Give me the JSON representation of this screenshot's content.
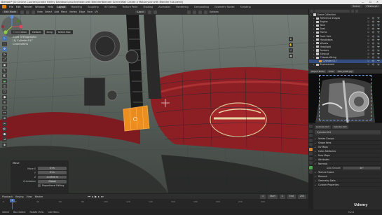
{
  "window": {
    "title": "Blender* [D:\\Online Courses\\Create Harley Davidson\\knucklehead with Blender\\Blender Scene\\Wall Create a Motorcycle with Blender 5.8.blend]",
    "controls": "—  ☐  ✕"
  },
  "menu": {
    "items": [
      "File",
      "Edit",
      "Render",
      "Window",
      "Help"
    ],
    "workspaces": [
      "Layout",
      "Modeling",
      "Sculpting",
      "UV Editing",
      "Texture Paint",
      "Shading",
      "Animation",
      "Rendering",
      "Compositing",
      "Geometry Nodes",
      "Scripting"
    ],
    "active_workspace": "Layout",
    "scene": "Scene",
    "view_layer": "ViewLayer"
  },
  "viewport_header": {
    "mode": "Edit Mode",
    "view": "View",
    "select": "Select",
    "add": "Add",
    "mesh": "Mesh",
    "vertex": "Vertex",
    "edge": "Edge",
    "face": "Face",
    "uv": "UV",
    "transform": "Local",
    "options": "Options"
  },
  "tool_header": {
    "orientation": "Orientation",
    "pivot": "Default",
    "drag": "Drag",
    "select_box": "Select Box"
  },
  "viewport_overlay": {
    "line1": "Right Orthographic",
    "line2": "(1) Cylinder.017",
    "line3": "Centimeters"
  },
  "toolbar": {
    "tools": [
      "↖",
      "⬚",
      "✥",
      "⟳",
      "⤢",
      "▣",
      "✎",
      "◧",
      "⬓",
      "◫",
      "⬡",
      "⬢",
      "◎",
      "⊙",
      "↔",
      "⊕",
      "✂",
      "◐",
      "⬣",
      "⊿",
      "◈"
    ]
  },
  "operator_panel": {
    "title": "Move",
    "fields": [
      {
        "label": "Move X",
        "value": "0 m"
      },
      {
        "label": "Y",
        "value": "0 m"
      },
      {
        "label": "Z",
        "value": "-0.0703 m"
      },
      {
        "label": "Orientation",
        "value": "Global"
      }
    ],
    "checkbox_label": "Proportional Editing"
  },
  "timeline": {
    "menus": [
      "Playback",
      "Keying",
      "View",
      "Marker"
    ],
    "current_frame": "1",
    "start_label": "Start",
    "start": "1",
    "end_label": "End",
    "end": "250",
    "ticks": [
      "0",
      "20",
      "40",
      "60",
      "80",
      "100",
      "120",
      "140",
      "160",
      "180",
      "200",
      "220",
      "240"
    ]
  },
  "statusbar": {
    "items": [
      "Select",
      "Box Select",
      "Rotate View",
      "Call Menu"
    ],
    "version": "3.2.0"
  },
  "watermark": "Udemy",
  "outliner": {
    "rows": [
      {
        "name": "Scene Collection",
        "type": "collection",
        "depth": 0,
        "selected": false,
        "flags": ""
      },
      {
        "name": "Reference Images",
        "type": "collection",
        "depth": 1,
        "selected": false,
        "flags": "☑ 👁 📷"
      },
      {
        "name": "Engine",
        "type": "collection",
        "depth": 1,
        "selected": false,
        "flags": "☑ 👁 📷"
      },
      {
        "name": "Tank",
        "type": "collection",
        "depth": 1,
        "selected": false,
        "flags": "☑ 👁 📷"
      },
      {
        "name": "Seat",
        "type": "collection",
        "depth": 1,
        "selected": false,
        "flags": "☑ 👁 📷"
      },
      {
        "name": "Frame",
        "type": "collection",
        "depth": 1,
        "selected": false,
        "flags": "☑ 👁 📷"
      },
      {
        "name": "Front Fork",
        "type": "collection",
        "depth": 1,
        "selected": false,
        "flags": "☑ 👁 📷"
      },
      {
        "name": "Handlebars",
        "type": "collection",
        "depth": 1,
        "selected": false,
        "flags": "☑ 👁 📷"
      },
      {
        "name": "Wheels",
        "type": "collection",
        "depth": 1,
        "selected": false,
        "flags": "☑ 👁 📷"
      },
      {
        "name": "Headlight",
        "type": "collection",
        "depth": 1,
        "selected": false,
        "flags": "☑ 👁 📷"
      },
      {
        "name": "Fenders",
        "type": "collection",
        "depth": 1,
        "selected": false,
        "flags": "☑ 👁 📷"
      },
      {
        "name": "Exhaust",
        "type": "collection",
        "depth": 1,
        "selected": false,
        "flags": "☑ 👁 📷"
      },
      {
        "name": "Chassis Wiring",
        "type": "collection",
        "depth": 1,
        "selected": false,
        "flags": "☑ 👁 📷"
      },
      {
        "name": "Cylinder.017",
        "type": "mesh",
        "depth": 2,
        "selected": true,
        "flags": "☑ 👁 📷"
      },
      {
        "name": "Environment",
        "type": "collection",
        "depth": 1,
        "selected": false,
        "flags": "☑ 👁 📷"
      }
    ]
  },
  "camera_view": {
    "mode": "Object Mode",
    "view": "View",
    "camera": "IMG_0938.jpg"
  },
  "properties": {
    "header": [
      "Cylinder.017",
      "Cylinder.024"
    ],
    "object_name": "Cylinder.024",
    "sections": [
      "Vertex Groups",
      "Shape Keys",
      "UV Maps",
      "Color Attributes",
      "Face Maps",
      "Attributes",
      "Normals",
      "Auto Smooth",
      "Texture Space",
      "Remesh",
      "Geometry Data",
      "Custom Properties"
    ],
    "auto_smooth_value": "30°"
  },
  "colors": {
    "accent": "#e87d0d",
    "selection": "#4772b3",
    "selected_face": "#f5921e"
  }
}
